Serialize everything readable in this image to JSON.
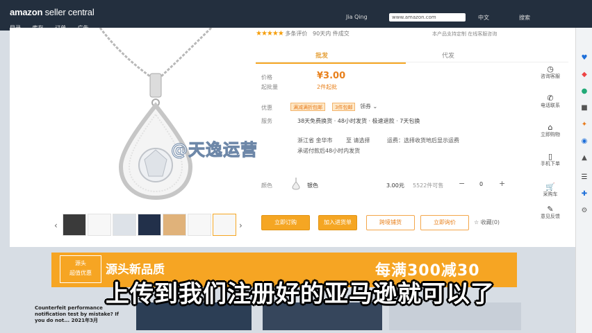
{
  "seller_header": {
    "logo_main": "amazon",
    "logo_sub": " seller central",
    "user": "Jia Qing",
    "store": "www.amazon.com",
    "lang": "中文",
    "search": "搜索",
    "nav": [
      "目录",
      "库存",
      "订单",
      "广告"
    ]
  },
  "product": {
    "rating_text": "多条评价",
    "sold_text": "90天内",
    "sold_suffix": "件成交",
    "rating_right": "本产品支持定制 在线客服咨询",
    "tabs": [
      "批发",
      "代发"
    ],
    "price_label": "价格",
    "price": "¥3.00",
    "moq_label": "起批量",
    "moq": "2件起批",
    "promo_label": "优惠",
    "promos": [
      "满减满折包邮",
      "3件包邮"
    ],
    "promo_more": "领券 ⌄",
    "service_label": "服务",
    "service": "38天免费换货 · 48小时发货 · 极速退款 · 7天包换",
    "ship_from": "浙江省 金华市",
    "ship_to": "至 请选择",
    "ship_fee": "运费：选择收货地后显示运费",
    "ship_time": "承诺付款后48小时内发货",
    "color_label": "颜色",
    "variant_name": "银色",
    "variant_price": "3.00元",
    "variant_stock": "5522件可售",
    "qty": "0",
    "btn_buy": "立即订购",
    "btn_cart": "加入进货单",
    "btn_dist": "跨境铺货",
    "btn_inquiry": "立即询价",
    "fav": "☆ 收藏(0)"
  },
  "sidebar": [
    {
      "icon": "◷",
      "label": "咨询客服"
    },
    {
      "icon": "✆",
      "label": "电话联系"
    },
    {
      "icon": "⌂",
      "label": "立即购物"
    },
    {
      "icon": "▯",
      "label": "手机下单"
    },
    {
      "icon": "🛒",
      "label": "采购车"
    },
    {
      "icon": "✎",
      "label": "意见反馈"
    }
  ],
  "banner": {
    "badge_line1": "源头",
    "badge_line2": "超值优惠",
    "left": "源头新品质",
    "right": "每满300减30"
  },
  "bottom": {
    "text": "Counterfeit performance notification test by mistake? If you do not... 2021年3月"
  },
  "overlay": {
    "watermark": "@天逸运营",
    "subtitle": "上传到我们注册好的亚马逊就可以了"
  },
  "colors": {
    "accent": "#f5a623",
    "price": "#e8801b",
    "header": "#232f3e"
  }
}
